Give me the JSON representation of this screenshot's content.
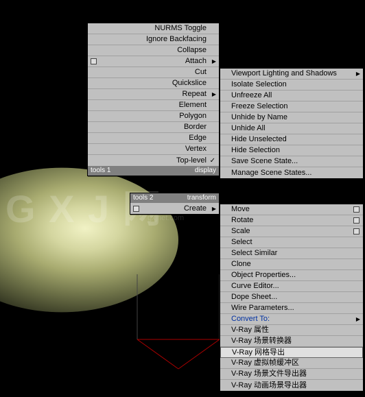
{
  "watermark": "G X J 网",
  "watermark_sub": "gxjnet.com",
  "menu_left": {
    "items": [
      {
        "label": "NURMS Toggle"
      },
      {
        "label": "Ignore Backfacing"
      },
      {
        "label": "Collapse"
      },
      {
        "label": "Attach",
        "square": true,
        "arrow": true
      },
      {
        "label": "Cut"
      },
      {
        "label": "Quickslice"
      },
      {
        "label": "Repeat",
        "arrow": true
      },
      {
        "label": "Element"
      },
      {
        "label": "Polygon"
      },
      {
        "label": "Border"
      },
      {
        "label": "Edge"
      },
      {
        "label": "Vertex"
      },
      {
        "label": "Top-level",
        "check": true
      }
    ],
    "footer_left": "tools 1",
    "footer_right": "display"
  },
  "menu_right_top": {
    "items": [
      {
        "label": "Viewport Lighting and Shadows",
        "arrow": true
      },
      {
        "label": "Isolate Selection"
      },
      {
        "label": "Unfreeze All"
      },
      {
        "label": "Freeze Selection"
      },
      {
        "label": "Unhide by Name"
      },
      {
        "label": "Unhide All"
      },
      {
        "label": "Hide Unselected"
      },
      {
        "label": "Hide Selection"
      },
      {
        "label": "Save Scene State..."
      },
      {
        "label": "Manage Scene States..."
      }
    ]
  },
  "menu_left2": {
    "items": [
      {
        "label": "Create",
        "square": true,
        "arrow": true
      }
    ],
    "footer_left": "tools 2",
    "footer_right": "transform"
  },
  "menu_right_bottom": {
    "items": [
      {
        "label": "Move",
        "trail_square": true
      },
      {
        "label": "Rotate",
        "trail_square": true
      },
      {
        "label": "Scale",
        "trail_square": true
      },
      {
        "label": "Select"
      },
      {
        "label": "Select Similar"
      },
      {
        "label": "Clone"
      },
      {
        "label": "Object Properties..."
      },
      {
        "label": "Curve Editor..."
      },
      {
        "label": "Dope Sheet..."
      },
      {
        "label": "Wire Parameters..."
      },
      {
        "label": "Convert To:",
        "blue": true,
        "arrow": true
      },
      {
        "label": "V-Ray 属性"
      },
      {
        "label": "V-Ray 场景转换器"
      },
      {
        "label": "V-Ray 网格导出",
        "highlighted": true
      },
      {
        "label": "V-Ray 虚拟帧缓冲区"
      },
      {
        "label": "V-Ray 场景文件导出器"
      },
      {
        "label": "V-Ray 动画场景导出器"
      }
    ]
  }
}
